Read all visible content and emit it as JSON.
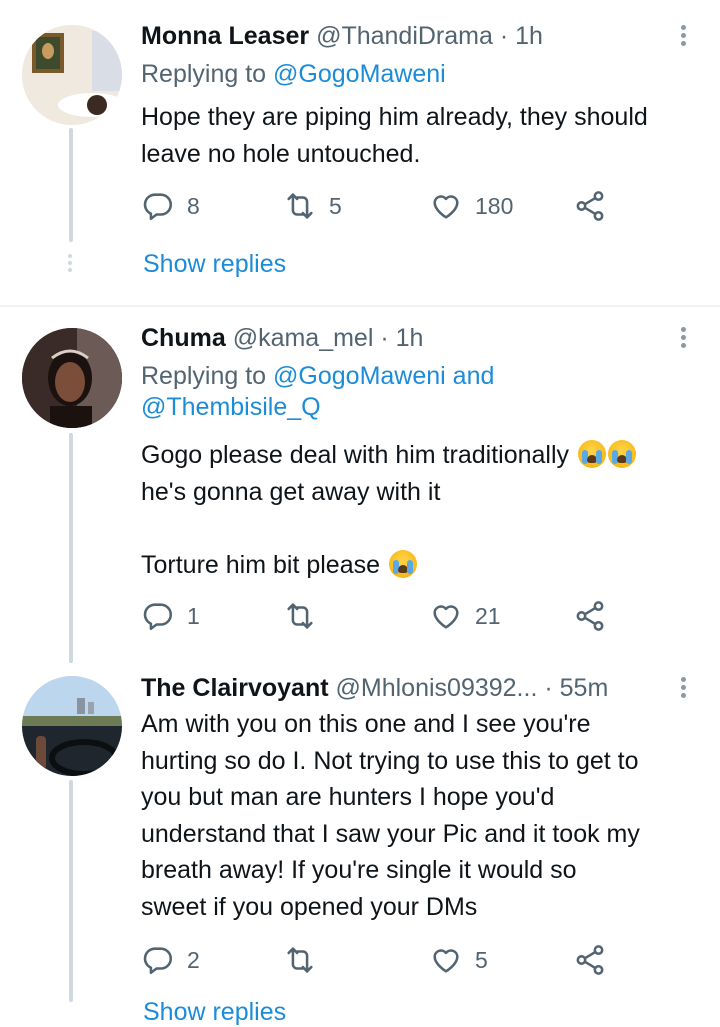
{
  "colors": {
    "link": "#1d8cd8",
    "secondary_text": "#536471",
    "primary_text": "#0f1419",
    "thread_line": "#cfd9de",
    "divider": "#eff3f4"
  },
  "tweets": [
    {
      "name": "Monna Leaser",
      "handle": "@ThandiDrama",
      "sep": "·",
      "time": "1h",
      "replying_prefix": "Replying to",
      "replying_to": [
        "@GogoMaweni"
      ],
      "text_lines": [
        "Hope they are piping him already, they should",
        "leave no hole untouched."
      ],
      "replies": "8",
      "retweets": "5",
      "likes": "180",
      "show_replies": "Show replies"
    },
    {
      "name": "Chuma",
      "handle": "@kama_mel",
      "sep": "·",
      "time": "1h",
      "replying_prefix": "Replying to",
      "replying_to": [
        "@GogoMaweni",
        "@Thembisile_Q"
      ],
      "replying_joiner": "and",
      "text_lines": [
        "Gogo please deal with him traditionally",
        "he's gonna get away with it",
        "Torture him bit please"
      ],
      "emoji": "loudly-crying-face",
      "replies": "1",
      "retweets": "",
      "likes": "21"
    },
    {
      "name": "The Clairvoyant",
      "handle": "@Mhlonis09392...",
      "sep": "·",
      "time": "55m",
      "text_lines": [
        "Am with you on this one and I see you're",
        "hurting so do I. Not trying to use this to get to",
        "you but man are hunters I hope you'd",
        "understand that I saw your Pic and it took my",
        "breath away! If you're single it would so",
        "sweet if you opened your DMs"
      ],
      "replies": "2",
      "retweets": "",
      "likes": "5",
      "show_replies": "Show replies"
    }
  ]
}
